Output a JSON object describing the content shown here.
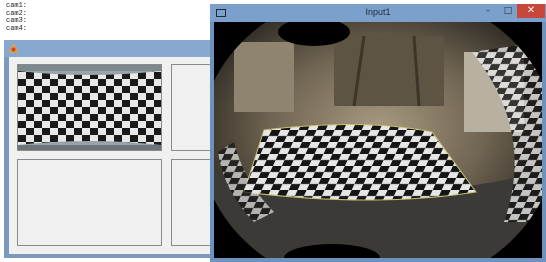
{
  "console": {
    "lines": [
      "cam1:",
      "cam2:",
      "cam3:",
      "cam4:"
    ]
  },
  "left_window": {
    "title": "",
    "icon": "app-icon"
  },
  "right_window": {
    "title": "Input1",
    "controls": {
      "minimize": "–",
      "maximize": "□",
      "close": "✕"
    }
  },
  "colors": {
    "title_active": "#7aa0cb",
    "title_inactive": "#88a8cf",
    "close_button": "#c7473a",
    "client_bg": "#f0f0f0"
  }
}
